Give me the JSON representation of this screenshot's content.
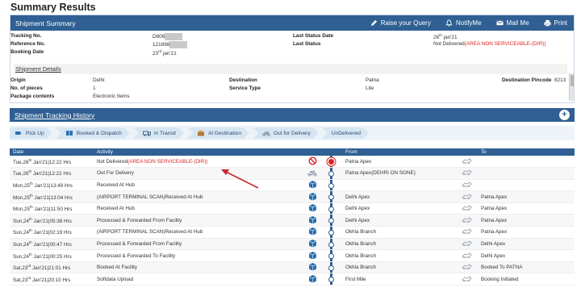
{
  "page_title": "Summary Results",
  "summary": {
    "title": "Shipment Summary",
    "actions": [
      {
        "label": "Raise your Query",
        "icon": "pencil-icon"
      },
      {
        "label": "NotifyMe",
        "icon": "bell-icon"
      },
      {
        "label": "Mail Me",
        "icon": "mail-icon"
      },
      {
        "label": "Print",
        "icon": "printer-icon"
      }
    ],
    "tracking_label": "Tracking No.",
    "tracking_value": "D806",
    "reference_label": "Reference No.",
    "reference_value": "121898",
    "booking_label": "Booking Date",
    "booking_value_day": "23",
    "booking_value_sup": "rd",
    "booking_value_rest": " jan'21",
    "last_status_date_label": "Last Status Date",
    "last_status_date_day": "26",
    "last_status_date_sup": "th",
    "last_status_date_rest": " jan'21",
    "last_status_label": "Last Status",
    "last_status_prefix": "Not Delivered",
    "last_status_reason": "(AREA NON SERVICEABLE-(DIR))"
  },
  "details": {
    "title": "Shipment Details",
    "origin_label": "Origin",
    "origin_value": "Delhi",
    "pieces_label": "No. of pieces",
    "pieces_value": "1",
    "contents_label": "Package contents",
    "contents_value": "Electronic Items",
    "destination_label": "Destination",
    "destination_value": "Patna",
    "service_label": "Service Type",
    "service_value": "Lite",
    "pincode_label": "Destination Pincode",
    "pincode_value": "8213"
  },
  "history": {
    "title": "Shipment Tracking History",
    "steps": [
      {
        "label": "Pick Up",
        "icon": "pickup-icon"
      },
      {
        "label": "Booked & Dispatch",
        "icon": "box-icon"
      },
      {
        "label": "In Transit",
        "icon": "truck-icon"
      },
      {
        "label": "At Destination",
        "icon": "package-open-icon"
      },
      {
        "label": "Out for Delivery",
        "icon": "scooter-icon"
      },
      {
        "label": "UnDelivered",
        "icon": ""
      }
    ],
    "columns": [
      "Date",
      "Activity",
      "From",
      "To"
    ],
    "rows": [
      {
        "day": "Tue,26",
        "sup": "th",
        "rest": " Jan'21|12:22 Hrs",
        "activity": "Not Delivered",
        "activity_red": "(AREA NON SERVICEABLE-(DIR))",
        "from": "Patna Apex",
        "to": "",
        "icon": "no-entry-icon"
      },
      {
        "day": "Tue,26",
        "sup": "th",
        "rest": " Jan'21|12:22 Hrs",
        "activity": "Out For Delivery",
        "activity_red": "",
        "from": "Patna Apex(DEHRI ON SONE)",
        "to": "",
        "icon": "scooter-icon"
      },
      {
        "day": "Mon,25",
        "sup": "th",
        "rest": " Jan'21|13:49 Hrs",
        "activity": "Received At Hub",
        "activity_red": "",
        "from": "",
        "to": "",
        "icon": "box-icon"
      },
      {
        "day": "Mon,25",
        "sup": "th",
        "rest": " Jan'21|13:04 Hrs",
        "activity": "(AIRPORT TERMINAL SCAN)Received At Hub",
        "activity_red": "",
        "from": "Delhi Apex",
        "to": "Patna Apex",
        "icon": "box-icon"
      },
      {
        "day": "Mon,25",
        "sup": "th",
        "rest": " Jan'21|11:50 Hrs",
        "activity": "Received At Hub",
        "activity_red": "",
        "from": "Delhi Apex",
        "to": "Patna Apex",
        "icon": "box-icon"
      },
      {
        "day": "Sun,24",
        "sup": "th",
        "rest": " Jan'21|05:38 Hrs",
        "activity": "Processed & Forwarded From Facility",
        "activity_red": "",
        "from": "Delhi Apex",
        "to": "Patna Apex",
        "icon": "box-icon"
      },
      {
        "day": "Sun,24",
        "sup": "th",
        "rest": " Jan'21|02:19 Hrs",
        "activity": "(AIRPORT TERMINAL SCAN)Received At Hub",
        "activity_red": "",
        "from": "Okhla Branch",
        "to": "Patna Apex",
        "icon": "box-icon"
      },
      {
        "day": "Sun,24",
        "sup": "th",
        "rest": " Jan'21|00:47 Hrs",
        "activity": "Processed & Forwarded From Facility",
        "activity_red": "",
        "from": "Okhla Branch",
        "to": "Delhi Apex",
        "icon": "box-icon"
      },
      {
        "day": "Sun,24",
        "sup": "th",
        "rest": " Jan'21|00:25 Hrs",
        "activity": "Processed & Forwarded To Facility",
        "activity_red": "",
        "from": "Okhla Branch",
        "to": "Delhi Apex",
        "icon": "box-icon"
      },
      {
        "day": "Sat,23",
        "sup": "rd",
        "rest": " Jan'21|21:01 Hrs",
        "activity": "Booked At Facility",
        "activity_red": "",
        "from": "Okhla Branch",
        "to": "Booked To PATNA",
        "icon": "box-icon"
      },
      {
        "day": "Sat,23",
        "sup": "rd",
        "rest": " Jan'21|20:10 Hrs",
        "activity": "Softdata Upload",
        "activity_red": "",
        "from": "First Mile",
        "to": "Booking Initiated",
        "icon": "box-icon"
      }
    ]
  },
  "colors": {
    "header": "#2f5f93",
    "status_red": "#d22",
    "annotation_arrow": "#c8282e"
  }
}
